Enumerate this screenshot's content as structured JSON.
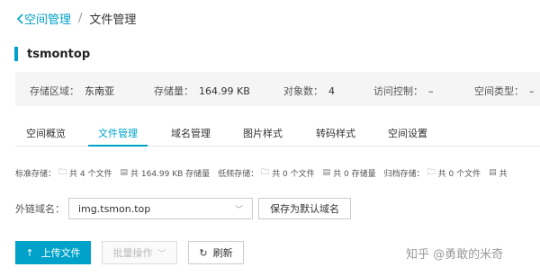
{
  "breadcrumb": {
    "back_label": "空间管理",
    "separator": "/",
    "current": "文件管理"
  },
  "bucket": {
    "name": "tsmontop"
  },
  "info": [
    {
      "label": "存储区域：",
      "value": "东南亚"
    },
    {
      "label": "存储量：",
      "value": "164.99 KB"
    },
    {
      "label": "对象数：",
      "value": "4"
    },
    {
      "label": "访问控制：",
      "value": "–"
    },
    {
      "label": "空间类型：",
      "value": "–"
    }
  ],
  "tabs": [
    "空间概览",
    "文件管理",
    "域名管理",
    "图片样式",
    "转码样式",
    "空间设置"
  ],
  "active_tab": "文件管理",
  "stats": {
    "standard_label": "标准存储：",
    "standard_files": "共 4 个文件",
    "standard_size": "共 164.99 KB 存储量",
    "low_label": "低频存储：",
    "low_files": "共 0 个文件",
    "low_size": "共 0 存储量",
    "archive_label": "归档存储：",
    "archive_files": "共 0 个文件",
    "extra_files": "共"
  },
  "domain": {
    "label": "外链域名：",
    "value": "img.tsmon.top",
    "save_default_label": "保存为默认域名"
  },
  "actions": {
    "upload_label": "上传文件",
    "batch_label": "批量操作",
    "refresh_label": "刷新"
  },
  "watermark": "知乎 @勇敢的米奇",
  "colors": {
    "accent": "#00a2ca"
  }
}
